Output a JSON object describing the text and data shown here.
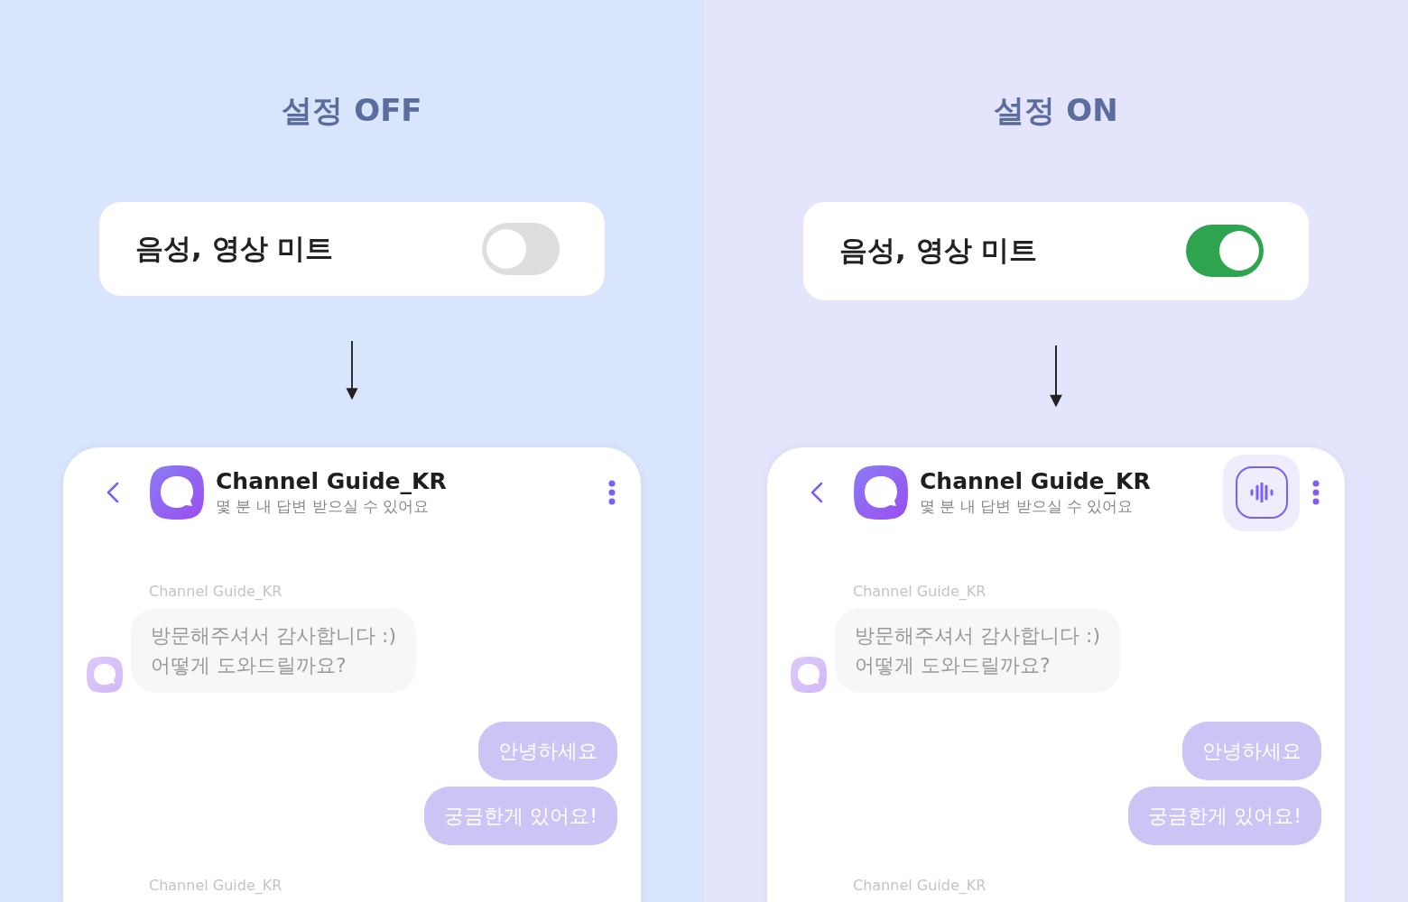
{
  "panels": [
    {
      "title": "설정 OFF",
      "setting": {
        "label": "음성, 영상 미트",
        "on": false
      },
      "chat": {
        "name": "Channel Guide_KR",
        "status": "몇 분 내 답변 받으실 수 있어요",
        "voice_button": false,
        "messages": [
          {
            "kind": "bot",
            "sender": "Channel Guide_KR",
            "lines": [
              "방문해주셔서 감사합니다 :)",
              "어떻게 도와드릴까요?"
            ]
          },
          {
            "kind": "user",
            "text": "안녕하세요"
          },
          {
            "kind": "user",
            "text": "궁금한게 있어요!"
          },
          {
            "kind": "sender",
            "sender": "Channel Guide_KR"
          }
        ]
      }
    },
    {
      "title": "설정 ON",
      "setting": {
        "label": "음성, 영상 미트",
        "on": true
      },
      "chat": {
        "name": "Channel Guide_KR",
        "status": "몇 분 내 답변 받으실 수 있어요",
        "voice_button": true,
        "messages": [
          {
            "kind": "bot",
            "sender": "Channel Guide_KR",
            "lines": [
              "방문해주셔서 감사합니다 :)",
              "어떻게 도와드릴까요?"
            ]
          },
          {
            "kind": "user",
            "text": "안녕하세요"
          },
          {
            "kind": "user",
            "text": "궁금한게 있어요!"
          },
          {
            "kind": "sender",
            "sender": "Channel Guide_KR"
          }
        ]
      }
    }
  ]
}
